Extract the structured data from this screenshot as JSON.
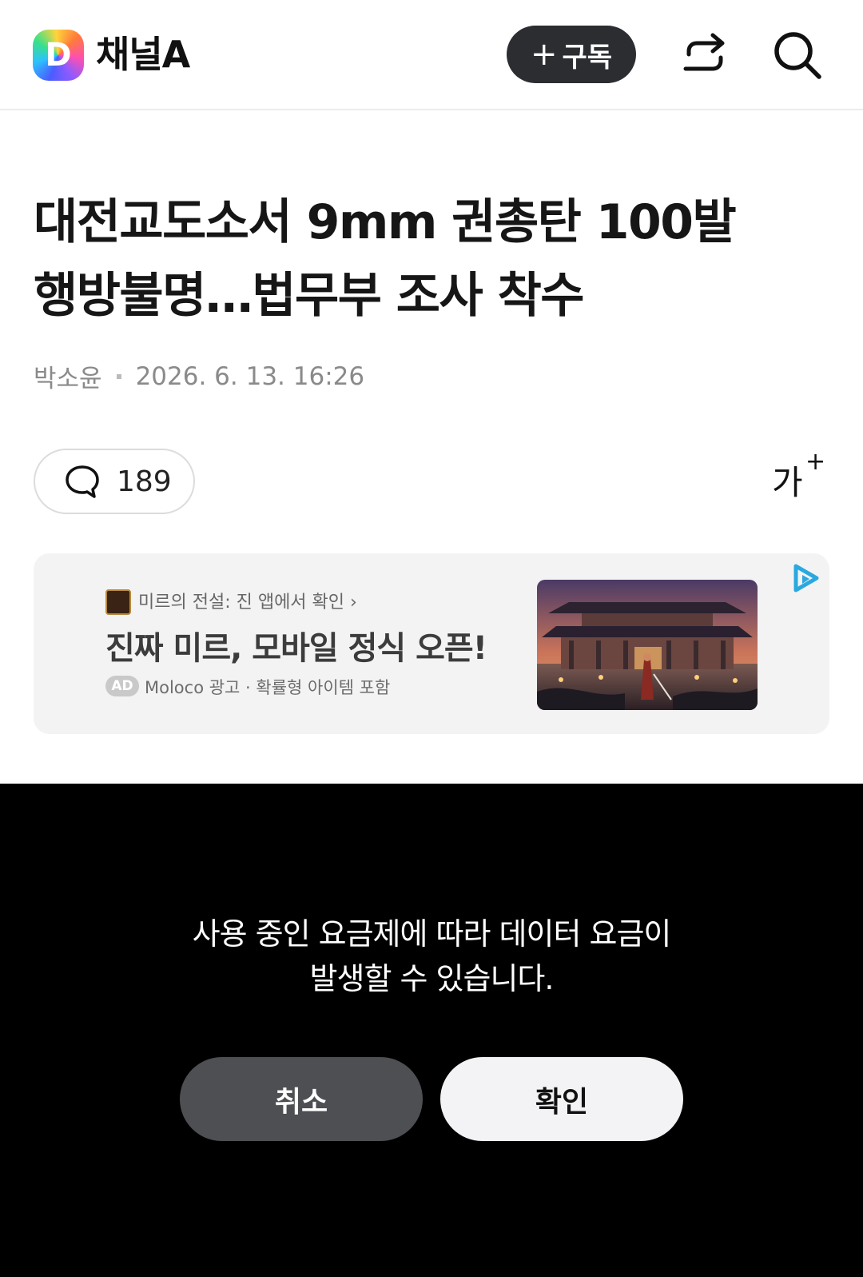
{
  "header": {
    "logo_letter": "D",
    "channel_name": "채널A",
    "subscribe_label": "구독",
    "subscribe_icon": "plus-icon",
    "share_icon": "share-icon",
    "search_icon": "search-icon"
  },
  "article": {
    "title_line1": "대전교도소서 9mm 권총탄 100발",
    "title_line2": "행방불명…법무부 조사 착수",
    "author": "박소윤",
    "datetime": "2026. 6. 13. 16:26",
    "comment_icon": "comment-icon",
    "comment_count": "189",
    "font_size_label": "가",
    "font_size_sup": "+"
  },
  "ad": {
    "app_line": "미르의 전설: 진 앱에서 확인 ›",
    "headline": "진짜 미르, 모바일 정식 오픈!",
    "badge": "AD",
    "disclaimer": "Moloco 광고 · 확률형 아이템 포함",
    "choices_icon": "ad-choices-icon"
  },
  "dialog": {
    "message": "사용 중인 요금제에 따라 데이터 요금이\n발생할 수 있습니다.",
    "cancel_label": "취소",
    "confirm_label": "확인"
  },
  "colors": {
    "subscribe_bg": "#2b2d31",
    "overlay_bg": "#000000",
    "cancel_bg": "#4d4f52",
    "confirm_bg": "#f3f3f6",
    "ad_bg": "#f3f3f4"
  }
}
